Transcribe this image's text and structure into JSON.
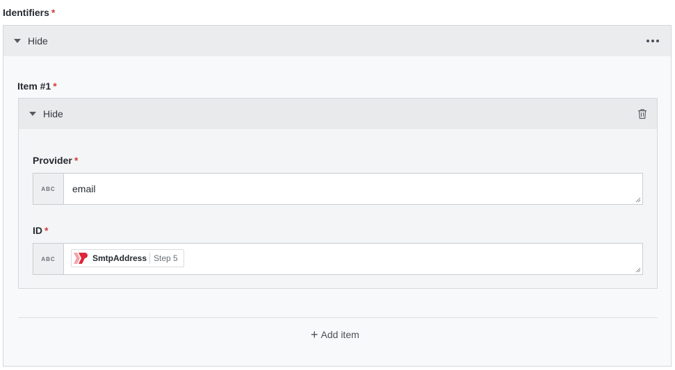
{
  "identifiers": {
    "label": "Identifiers",
    "required_mark": "*",
    "toggle_label": "Hide"
  },
  "item": {
    "label": "Item #1",
    "required_mark": "*",
    "toggle_label": "Hide"
  },
  "provider": {
    "label": "Provider",
    "required_mark": "*",
    "type_tag": "ABC",
    "value": "email"
  },
  "id_field": {
    "label": "ID",
    "required_mark": "*",
    "type_tag": "ABC",
    "token_name": "SmtpAddress",
    "token_step": "Step 5"
  },
  "add_item_label": "Add item",
  "icons": {
    "more": "more-horizontal-icon",
    "trash": "trash-icon",
    "caret": "caret-down-icon",
    "plus": "plus-icon",
    "logo": "app-logo-icon"
  },
  "colors": {
    "required": "#d23b3b",
    "logo_red": "#e0263a"
  }
}
